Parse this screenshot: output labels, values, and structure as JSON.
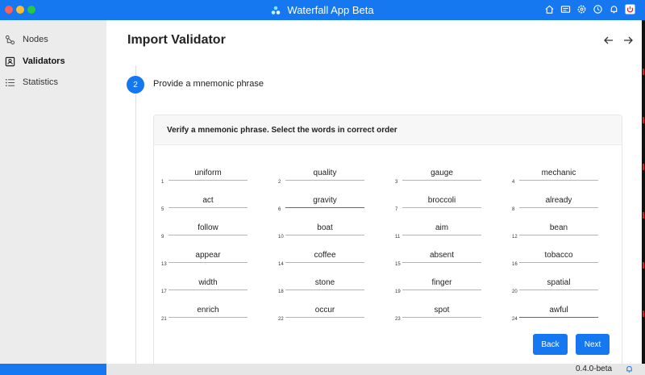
{
  "window": {
    "title": "Waterfall App Beta"
  },
  "titlebar_icons": [
    "home-icon",
    "card-icon",
    "gear-icon",
    "clock-icon",
    "bell-icon",
    "power-icon"
  ],
  "sidebar": {
    "items": [
      {
        "label": "Nodes",
        "icon": "nodes-icon",
        "active": false
      },
      {
        "label": "Validators",
        "icon": "validator-icon",
        "active": true
      },
      {
        "label": "Statistics",
        "icon": "list-icon",
        "active": false
      }
    ]
  },
  "main": {
    "title": "Import Validator",
    "step": {
      "number": "2",
      "label": "Provide a mnemonic phrase"
    },
    "card": {
      "title": "Verify a mnemonic phrase. Select the words in correct order",
      "words": [
        {
          "num": "1",
          "word": "uniform"
        },
        {
          "num": "2",
          "word": "quality"
        },
        {
          "num": "3",
          "word": "gauge"
        },
        {
          "num": "4",
          "word": "mechanic"
        },
        {
          "num": "5",
          "word": "act"
        },
        {
          "num": "6",
          "word": "gravity"
        },
        {
          "num": "7",
          "word": "broccoli"
        },
        {
          "num": "8",
          "word": "already"
        },
        {
          "num": "9",
          "word": "follow"
        },
        {
          "num": "10",
          "word": "boat"
        },
        {
          "num": "11",
          "word": "aim"
        },
        {
          "num": "12",
          "word": "bean"
        },
        {
          "num": "13",
          "word": "appear"
        },
        {
          "num": "14",
          "word": "coffee"
        },
        {
          "num": "15",
          "word": "absent"
        },
        {
          "num": "16",
          "word": "tobacco"
        },
        {
          "num": "17",
          "word": "width"
        },
        {
          "num": "18",
          "word": "stone"
        },
        {
          "num": "19",
          "word": "finger"
        },
        {
          "num": "20",
          "word": "spatial"
        },
        {
          "num": "21",
          "word": "enrich"
        },
        {
          "num": "22",
          "word": "occur"
        },
        {
          "num": "23",
          "word": "spot"
        },
        {
          "num": "24",
          "word": "awful"
        }
      ],
      "back_label": "Back",
      "next_label": "Next"
    }
  },
  "status": {
    "version": "0.4.0-beta"
  },
  "colors": {
    "accent": "#1678f0",
    "sidebar_bg": "#ececec"
  }
}
